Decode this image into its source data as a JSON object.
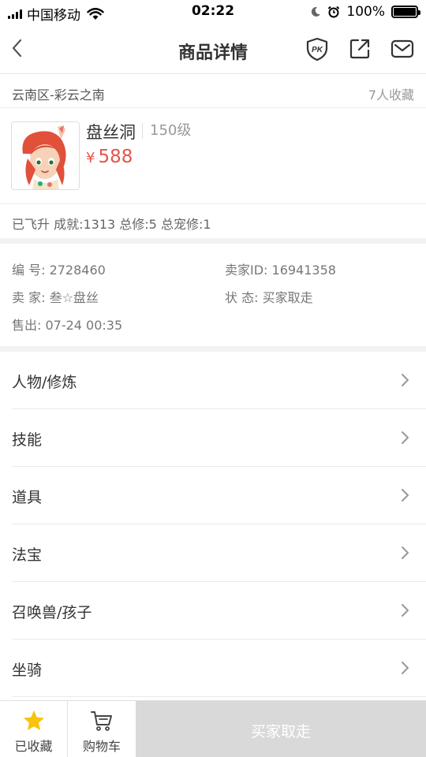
{
  "status_bar": {
    "carrier": "中国移动",
    "time": "02:22",
    "battery": "100%",
    "battery_level": 1.0
  },
  "nav": {
    "title": "商品详情",
    "pk_label": "PK"
  },
  "server": {
    "name": "云南区-彩云之南",
    "favorites": "7人收藏"
  },
  "product": {
    "name": "盘丝洞",
    "level": "150级",
    "price_symbol": "¥",
    "price": "588",
    "stats": "已飞升 成就:1313 总修:5 总宠修:1"
  },
  "info": {
    "id": "编  号: 2728460",
    "seller_id": "卖家ID: 16941358",
    "seller": "卖  家: 叁☆盘丝",
    "status": "状  态: 买家取走",
    "sold": "售出: 07-24 00:35"
  },
  "menu": [
    {
      "label": "人物/修炼"
    },
    {
      "label": "技能"
    },
    {
      "label": "道具"
    },
    {
      "label": "法宝"
    },
    {
      "label": "召唤兽/孩子"
    },
    {
      "label": "坐骑"
    }
  ],
  "bottom": {
    "favorited_label": "已收藏",
    "cart_label": "购物车",
    "buy_label": "买家取走"
  },
  "colors": {
    "price": "#e4554f",
    "star": "#f7c30d",
    "disabled_button": "#d9d9d9"
  }
}
